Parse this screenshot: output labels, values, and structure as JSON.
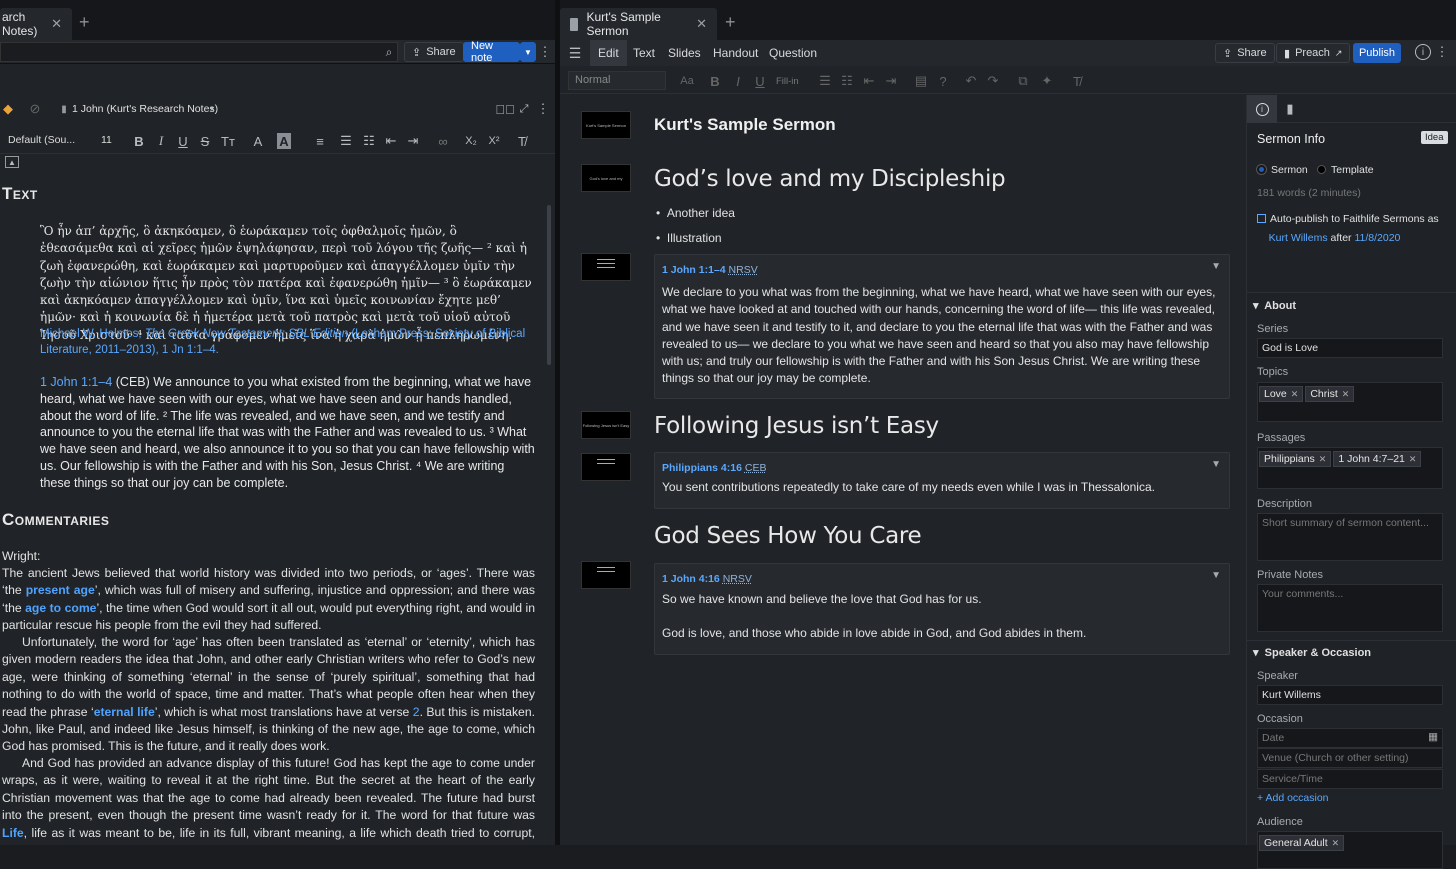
{
  "left_tab": {
    "title": "arch Notes)"
  },
  "right_tab": {
    "title": "Kurt's Sample Sermon"
  },
  "left_toolbar": {
    "share": "Share",
    "new_note": "New note"
  },
  "notebook": {
    "name": "1 John (Kurt's Research Notes)"
  },
  "format": {
    "font": "Default (Sou...",
    "size": "11",
    "sub": "X₂",
    "sup": "X²"
  },
  "doc": {
    "text_heading": "Text",
    "greek": "Ὃ ἦν ἀπ’ ἀρχῆς, ὃ ἀκηκόαμεν, ὃ ἑωράκαμεν τοῖς ὀφθαλμοῖς ἡμῶν, ὃ ἐθεασάμεθα καὶ αἱ χεῖρες ἡμῶν ἐψηλάφησαν, περὶ τοῦ λόγου τῆς ζωῆς— ² καὶ ἡ ζωὴ ἐφανερώθη, καὶ ἑωράκαμεν καὶ μαρτυροῦμεν καὶ ἀπαγγέλλομεν ὑμῖν τὴν ζωὴν τὴν αἰώνιον ἥτις ἦν πρὸς τὸν πατέρα καὶ ἐφανερώθη ἡμῖν— ³ ὃ ἑωράκαμεν καὶ ἀκηκόαμεν ἀπαγγέλλομεν  καὶ ὑμῖν, ἵνα καὶ ὑμεῖς κοινωνίαν ἔχητε μεθ’ ἡμῶν· καὶ ἡ κοινωνία δὲ ἡ ἡμετέρα μετὰ τοῦ πατρὸς καὶ μετὰ τοῦ υἱοῦ αὐτοῦ Ἰησοῦ Χριστοῦ· ⁴ καὶ ταῦτα γράφομεν  ἡμεῖς ἵνα ἡ χαρὰ ἡμῶν ᾖ πεπληρωμένη.",
    "greek_cite_a": "Michael W. Holmes, ",
    "greek_cite_b": "The Greek New Testament: SBL Edition",
    "greek_cite_c": " (Lexham Press; Society of Biblical Literature, 2011–2013), 1 Jn 1:1–4.",
    "ceb_ref": "1 John 1:1–4",
    "ceb_text": " (CEB) We announce to you what existed from the beginning, what we have heard, what we have seen with our eyes, what we have seen and our hands handled, about the word of life. ² The life was revealed, and we have seen, and we testify and announce to you the eternal life that was with the Father and was revealed to us. ³ What we have seen and heard, we also announce it to you so that you can have fellowship with us. Our fellowship is with the Father and with his Son, Jesus Christ. ⁴ We are writing these things so that our joy can be complete.",
    "comm_heading": "Commentaries",
    "wright": "Wright:",
    "p1a": "The ancient Jews believed that world history was divided into two periods, or ‘ages’. There was ‘the ",
    "p1b": "present age",
    "p1c": "’, which was full of misery and suffering, injustice and oppression; and there was ‘the ",
    "p1d": "age to come",
    "p1e": "’, the time when God would sort it all out, would put everything right, and would in particular rescue his people from the evil they had suffered.",
    "p2a": "Unfortunately, the word for ‘age’ has often been translated as ‘eternal’ or ‘eternity’, which has given modern readers the idea that John, and other early Christian writers who refer to God’s new age, were thinking of something ‘eternal’ in the sense of ‘purely spiritual’, something that had nothing to do with the world of space, time and matter. That’s what people often hear when they read the phrase ‘",
    "p2b": "eternal life",
    "p2c": "’, which is what most translations have at verse ",
    "p2d": "2",
    "p2e": ". But this is mistaken. John, like Paul, and indeed like Jesus himself, is thinking of the new age, the age to come, which God has promised. This is the future, and it really does work.",
    "p3a": "And God has provided an advance display of this future! God has kept the age to come under wraps, as it were, waiting to reveal it at the right time. But the secret at the heart of the early Christian movement was that the age to come had already been revealed. The future had burst into the present, even though the present time wasn’t ready for it. The word for that future was ",
    "p3b": "Life",
    "p3c": ", life as it was meant to be, life in its full, vibrant meaning, a life which death tried to corrupt, thwart and kill but"
  },
  "mid_tabs": [
    "Edit",
    "Text",
    "Slides",
    "Handout",
    "Question"
  ],
  "mid_toolbar": {
    "share": "Share",
    "preach": "Preach",
    "publish": "Publish",
    "style": "Normal",
    "fillin": "Fill-in"
  },
  "sermon": {
    "title": "Kurt's Sample Sermon",
    "thumb1": "Kurt's Sample Sermon",
    "s1": "God’s love and my Discipleship",
    "thumb2": "God's love and my Discipleship",
    "bullets": [
      "Another idea",
      "Illustration"
    ],
    "c1_ref": "1 John 1:1–4",
    "c1_ver": "NRSV",
    "c1_text": "We declare to you what was from the beginning, what we have heard, what we have seen with our eyes, what we have looked at and touched with our hands, concerning the word of life— this life was revealed, and we have seen it and testify to it, and declare to you the eternal life that was with the Father and was revealed to us— we declare to you what we have seen and heard so that you also may have fellowship with us; and truly our fellowship is with the Father and with his Son Jesus Christ. We are writing these things so that our joy may be complete.",
    "s2": "Following Jesus isn’t Easy",
    "thumb4": "Following Jesus isn't Easy",
    "c2_ref": "Philippians 4:16",
    "c2_ver": "CEB",
    "c2_text": "You sent contributions repeatedly to take care of my needs even while I was in Thessalonica.",
    "s3": "God Sees How You Care",
    "c3_ref": "1 John 4:16",
    "c3_ver": "NRSV",
    "c3_text1": "So we have known and believe the love that God has for us.",
    "c3_text2": "God is love, and those who abide in love abide in God, and God abides in them."
  },
  "info": {
    "title": "Sermon Info",
    "idea": "Idea",
    "sermon": "Sermon",
    "template": "Template",
    "words": "181 words (2 minutes)",
    "autopub": "Auto-publish to Faithlife Sermons as",
    "author": "Kurt Willems",
    "after": "after",
    "date": "11/8/2020",
    "about": "About",
    "series_label": "Series",
    "series": "God is Love",
    "topics_label": "Topics",
    "topics": [
      "Love",
      "Christ"
    ],
    "passages_label": "Passages",
    "passages": [
      "Philippians",
      "1 John 4:7–21"
    ],
    "desc_label": "Description",
    "desc_ph": "Short summary of sermon content...",
    "notes_label": "Private Notes",
    "notes_ph": "Your comments...",
    "speaker_sec": "Speaker & Occasion",
    "speaker_label": "Speaker",
    "speaker": "Kurt Willems",
    "occasion_label": "Occasion",
    "date_ph": "Date",
    "venue_ph": "Venue (Church or other setting)",
    "service_ph": "Service/Time",
    "add_occasion": "+ Add occasion",
    "audience_label": "Audience",
    "audience": [
      "General Adult"
    ]
  },
  "colors": {
    "accent": "#1f5fbf",
    "link": "#5aa8ff",
    "bg": "#202327"
  }
}
